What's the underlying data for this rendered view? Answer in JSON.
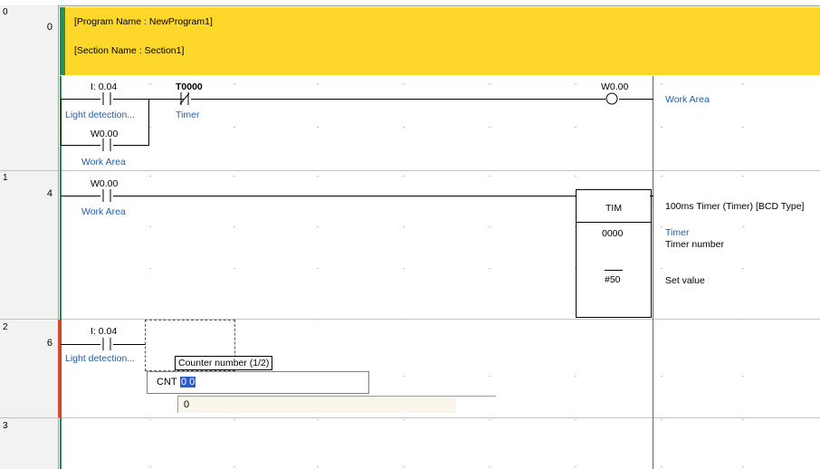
{
  "header": {
    "program_name": "[Program Name : NewProgram1]",
    "section_name": "[Section Name : Section1]"
  },
  "rungs": [
    {
      "rung": "0",
      "step": "0"
    },
    {
      "rung": "1",
      "step": "4"
    },
    {
      "rung": "2",
      "step": "6"
    },
    {
      "rung": "3",
      "step": ""
    }
  ],
  "rung0": {
    "contact1_addr": "I: 0.04",
    "contact1_comment": "Light detection...",
    "contact2_addr": "T0000",
    "contact2_comment": "Timer",
    "contact3_addr": "W0.00",
    "contact3_comment": "Work Area",
    "coil_addr": "W0.00",
    "coil_comment": "Work Area"
  },
  "rung1": {
    "contact_addr": "W0.00",
    "contact_comment": "Work Area",
    "instr": "TIM",
    "operand1": "0000",
    "operand2": "#50",
    "desc_title": "100ms Timer (Timer) [BCD Type]",
    "desc_op1_name": "Timer",
    "desc_op1_label": "Timer number",
    "desc_op2_label": "Set value"
  },
  "rung2": {
    "contact_addr": "I: 0.04",
    "contact_comment": "Light detection...",
    "tooltip": "Counter number (1/2)",
    "editor_prefix": "CNT",
    "editor_value": "0 0",
    "candidate": "0"
  }
}
